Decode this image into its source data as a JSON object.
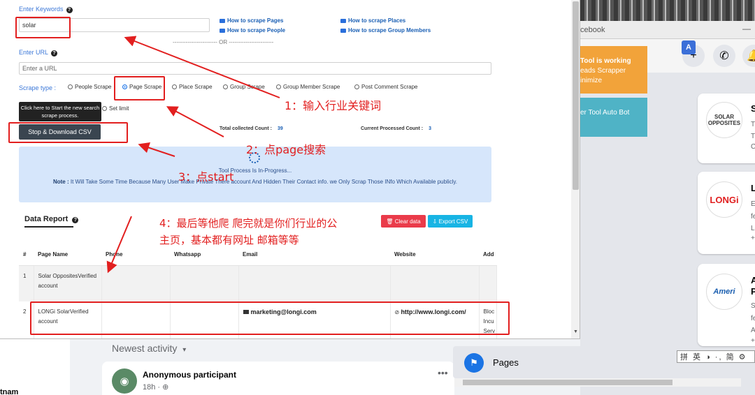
{
  "fb": {
    "window_title": "cebook",
    "minimize": "—",
    "toast_title": "Tool is working",
    "toast_line2": "eads Scrapper",
    "toast_line3": "inimize",
    "teal_text": "er Tool Auto Bot",
    "side_cards": [
      {
        "logo": "SOLAR OPPOSITES",
        "letter": "S",
        "lines": [
          "T",
          "T",
          "C"
        ]
      },
      {
        "logo": "LONGi",
        "letter": "L",
        "lines": [
          "E",
          "fe",
          "Lo",
          "+"
        ]
      },
      {
        "logo": "Ameri",
        "letter": "A",
        "lines": [
          "P",
          "S",
          "fe",
          "A",
          "+"
        ]
      }
    ],
    "newest_activity": "Newest activity",
    "newest_caret": "▾",
    "anon_name": "Anonymous participant",
    "anon_time": "18h · ",
    "pages_label": "Pages",
    "vietnam": "tnam",
    "ime_bar": "拼 英 ◑ ·, 简 ⚙"
  },
  "form": {
    "keywords_label": "Enter Keywords",
    "keywords_value": "solar",
    "url_label": "Enter URL",
    "url_placeholder": "Enter a URL",
    "or_separator": "------------------------ OR ------------------------",
    "howto": [
      "How to scrape Pages",
      "How to scrape Places",
      "How to scrape People",
      "How to scrape Group Members"
    ],
    "scrape_type_label": "Scrape type :",
    "scrape_types": [
      "People Scrape",
      "Page Scrape",
      "Place Scrape",
      "Group Scrape",
      "Group Member Scrape",
      "Post Comment Scrape"
    ],
    "selected_scrape_type": "Page Scrape",
    "tooltip": "Click here to Start the new search scrape process.",
    "set_limit": "Set limit",
    "stop_button": "Stop & Download CSV",
    "total_collected_label": "Total collected Count :",
    "total_collected": "39",
    "current_processed_label": "Current Processed Count :",
    "current_processed": "3"
  },
  "progress": {
    "status": "Tool Process Is In-Progress...",
    "note_label": "Note :",
    "note": "It Will Take Some Time Because Many User Make Private There account And Hidden Their Contact info. we Only Scrap Those INfo Which Available publicly."
  },
  "report": {
    "title": "Data Report",
    "clear_button": "Clear data",
    "export_button": "Export CSV",
    "columns": [
      "#",
      "Page Name",
      "Phone",
      "Whatsapp",
      "Email",
      "Website",
      "Add"
    ],
    "rows": [
      {
        "num": "1",
        "page_name": "Solar OppositesVerified account",
        "phone": "",
        "whatsapp": "",
        "email": "",
        "website": "",
        "address": ""
      },
      {
        "num": "2",
        "page_name": "LONGi SolarVerified account",
        "phone": "",
        "whatsapp": "",
        "email": "marketing@longi.com",
        "website": "http://www.longi.com/",
        "address": "Bloc Incu Serv"
      }
    ]
  },
  "annotations": {
    "a1": "1：输入行业关键词",
    "a2": "2：点page搜索",
    "a3": "3：点start",
    "a4_line1": "4：最后等他爬  爬完就是你们行业的公",
    "a4_line2": "主页，基本都有网址 邮箱等等"
  },
  "colors": {
    "accent_blue": "#3c78d8",
    "annotation_red": "#e21f1f",
    "stop_button": "#3a4550",
    "clear_red": "#ea3b4a",
    "export_cyan": "#17b4e4"
  }
}
